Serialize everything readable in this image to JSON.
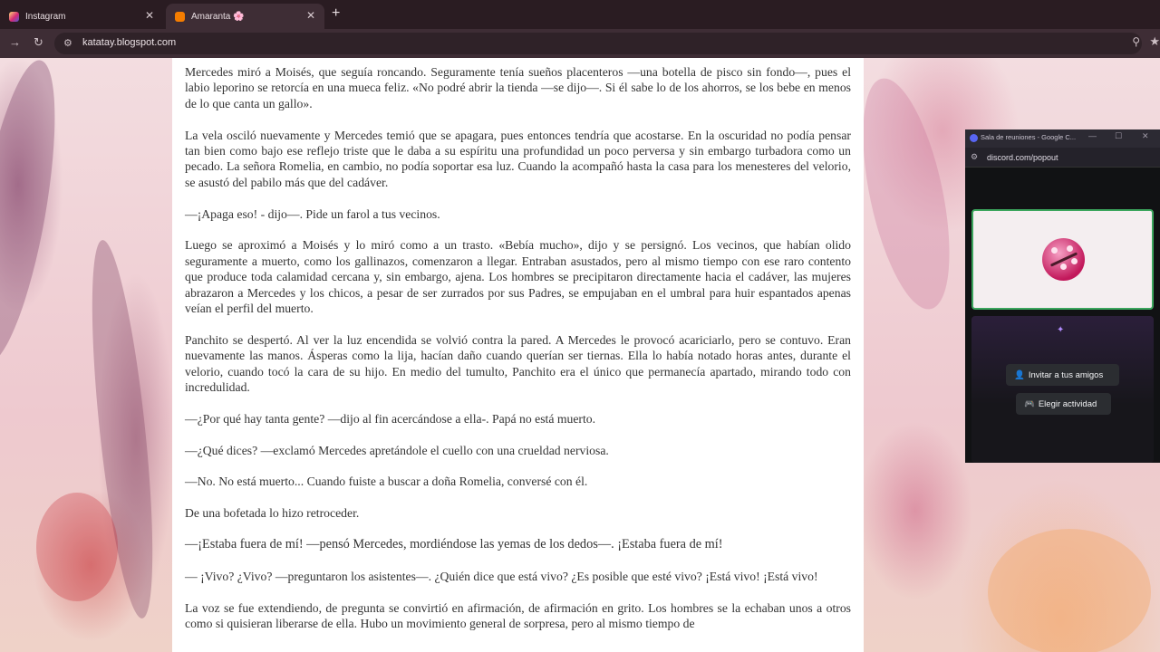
{
  "browser": {
    "tabs": [
      {
        "title": "Instagram",
        "icon": "instagram-icon",
        "active": false
      },
      {
        "title": "Amaranta 🌸",
        "icon": "blogger-icon",
        "active": true
      }
    ],
    "url": "katatay.blogspot.com"
  },
  "article": {
    "paragraphs": [
      "Mercedes miró a Moisés, que seguía roncando. Seguramente tenía sueños placenteros —una botella de pisco sin fondo—, pues el labio leporino se retorcía en una mueca feliz. «No podré abrir la tienda —se dijo—. Si él sabe lo de los ahorros, se los bebe en menos de lo que canta un gallo».",
      "La vela osciló nuevamente y Mercedes temió que se apagara, pues entonces tendría que acostarse. En la oscuridad no podía pensar tan bien como bajo ese reflejo triste que le daba a su espíritu una profundidad un poco perversa y sin embargo turbadora como un pecado. La señora Romelia, en cambio, no podía soportar esa luz. Cuando la acompañó hasta la casa para los menesteres del velorio, se asustó del pabilo más que del cadáver.",
      "—¡Apaga eso! - dijo—. Pide un farol a tus vecinos.",
      "Luego se aproximó a Moisés y lo miró como a un trasto. «Bebía mucho», dijo y se persignó. Los vecinos, que habían olido seguramente a muerto, como los gallinazos, comenzaron a llegar. Entraban asustados, pero al mismo tiempo con ese raro contento que produce toda calamidad cercana y, sin embargo, ajena. Los hombres se precipitaron directamente hacia el cadáver, las mujeres abrazaron a Mercedes y los chicos, a pesar de ser zurrados por sus Padres, se empujaban en el umbral para huir espantados apenas veían el perfil del muerto.",
      "Panchito se despertó. Al ver la luz encendida se volvió contra la pared. A Mercedes le provocó acariciarlo, pero se contuvo. Eran nuevamente las manos. Ásperas como la lija, hacían daño cuando querían ser tiernas. Ella lo había notado horas antes, durante el velorio, cuando tocó la cara de su hijo. En medio del tumulto, Panchito era el único que permanecía apartado, mirando todo con incredulidad.",
      "—¿Por qué hay tanta gente? —dijo al fin acercándose a ella-. Papá no está muerto.",
      "—¿Qué dices? —exclamó Mercedes apretándole el cuello con una crueldad nerviosa.",
      "—No. No está muerto... Cuando fuiste a buscar a doña Romelia, conversé con él.",
      "De una bofetada lo hizo retroceder.",
      "—¡Estaba fuera de mí! —pensó Mercedes, mordiéndose las yemas de los dedos—. ¡Estaba fuera de mí!",
      "— ¡Vivo? ¿Vivo? —preguntaron los asistentes—. ¿Quién dice que está vivo? ¿Es posible que esté vivo? ¡Está vivo! ¡Está vivo!",
      "La voz se fue extendiendo, de pregunta se convirtió en afirmación, de afirmación en grito. Los hombres se la echaban unos a otros como si quisieran liberarse de ella. Hubo un movimiento general de sorpresa, pero al mismo tiempo de"
    ]
  },
  "discord_popout": {
    "window_title": "Sala de reuniones - Google C...",
    "url": "discord.com/popout",
    "invite_button": "Invitar a tus amigos",
    "activity_button": "Elegir actividad"
  },
  "colors": {
    "call_border": "#3ba55d",
    "discord_bg": "#111214",
    "browser_chrome": "#3e2d35"
  }
}
